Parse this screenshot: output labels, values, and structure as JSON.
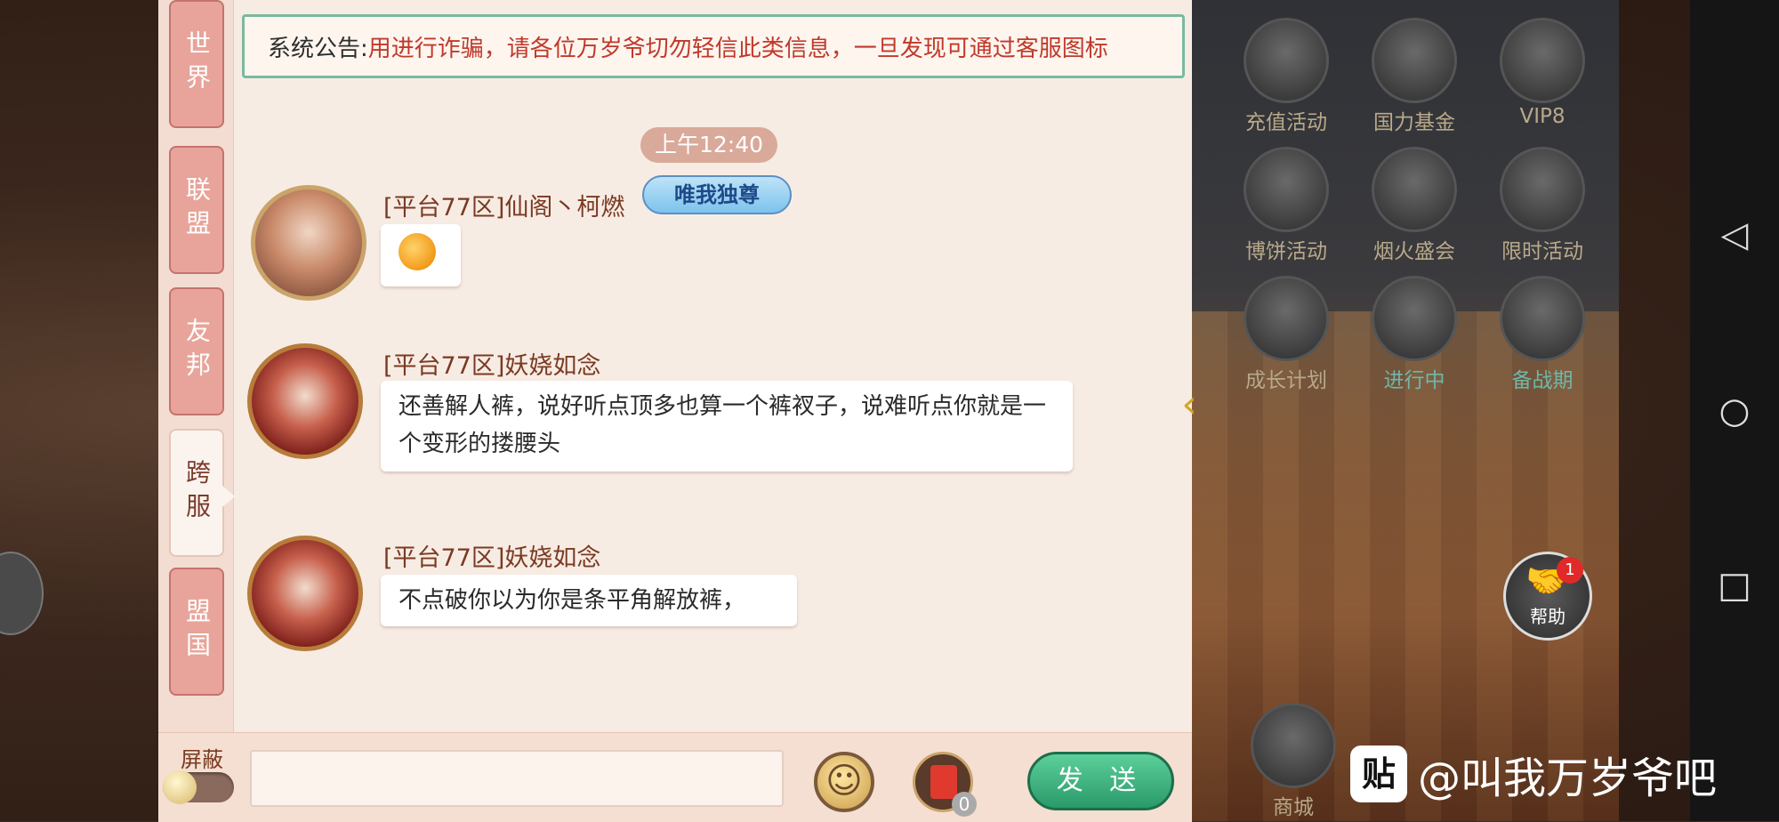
{
  "tabs": [
    {
      "label": "世界"
    },
    {
      "label": "联盟"
    },
    {
      "label": "友邦"
    },
    {
      "label": "跨服"
    },
    {
      "label": "盟国"
    }
  ],
  "announcement": {
    "label": "系统公告:",
    "text": "用进行诈骗，请各位万岁爷切勿轻信此类信息，一旦发现可通过客服图标"
  },
  "timestamp": "上午12:40",
  "messages": [
    {
      "sender": "[平台77区]仙阁丶柯燃",
      "badge": "唯我独尊",
      "content": "",
      "sticker": "tiger-emoji"
    },
    {
      "sender": "[平台77区]妖娆如念",
      "content": "还善解人裤，说好听点顶多也算一个裤衩子，说难听点你就是一个变形的搂腰头"
    },
    {
      "sender": "[平台77区]妖娆如念",
      "content": "不点破你以为你是条平角解放裤，"
    }
  ],
  "input_bar": {
    "block_label": "屏蔽",
    "input_value": "",
    "input_placeholder": "",
    "red_packet_count": "0",
    "send_label": "发 送"
  },
  "game_menu": [
    {
      "label": "充值活动",
      "icon": "treasure-icon"
    },
    {
      "label": "国力基金",
      "icon": "chest-icon"
    },
    {
      "label": "VIP8",
      "icon": "vip-avatar-icon"
    },
    {
      "label": "博饼活动",
      "icon": "dice-icon"
    },
    {
      "label": "烟火盛会",
      "icon": "firework-icon"
    },
    {
      "label": "限时活动",
      "icon": "bracelet-icon"
    },
    {
      "label": "成长计划",
      "icon": "scroll-icon"
    },
    {
      "label": "进行中",
      "icon": "beast-icon"
    },
    {
      "label": "备战期",
      "icon": "ship-icon"
    },
    {
      "label": "商城",
      "icon": "shop-icon"
    }
  ],
  "help": {
    "label": "帮助",
    "badge_count": "1"
  },
  "watermark": {
    "logo": "贴",
    "text": "@叫我万岁爷吧"
  },
  "colors": {
    "tab_inactive": "#e8a49a",
    "send_button": "#2a9a6a",
    "announcement_text": "#c0392b"
  }
}
